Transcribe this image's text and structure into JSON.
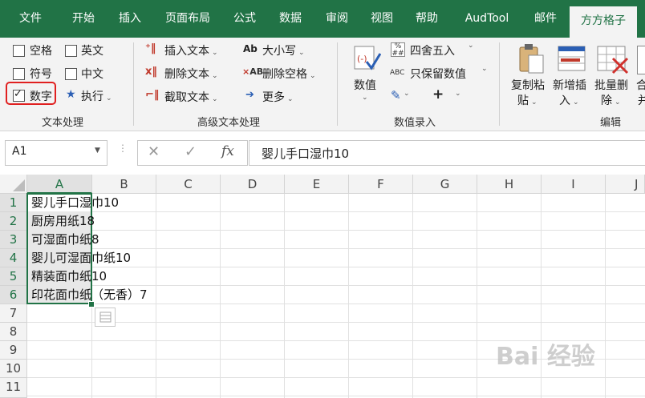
{
  "tabs": [
    "文件",
    "开始",
    "插入",
    "页面布局",
    "公式",
    "数据",
    "审阅",
    "视图",
    "帮助",
    "AudTool",
    "邮件",
    "方方格子"
  ],
  "active_tab": "方方格子",
  "ribbon": {
    "text_processing": {
      "checkboxes": {
        "space": "空格",
        "english": "英文",
        "symbol": "符号",
        "chinese": "中文",
        "digit": "数字"
      },
      "execute_label": "执行",
      "group_label": "文本处理"
    },
    "advanced_text": {
      "insert_text": "插入文本",
      "delete_text": "删除文本",
      "extract_text": "截取文本",
      "case_prefix": "Ab",
      "case_label": "大小写",
      "del_space_prefix": "AB",
      "del_space_label": "删除空格",
      "more_label": "更多",
      "group_label": "高级文本处理"
    },
    "number_entry": {
      "value_label": "数值",
      "round_label": "四舍五入",
      "keep_prefix": "ABC",
      "keep_value_label": "只保留数值",
      "plus_label": "+",
      "group_label": "数值录入"
    },
    "edit": {
      "copy_paste_l1": "复制粘",
      "copy_paste_l2": "贴",
      "new_insert_l1": "新增插",
      "new_insert_l2": "入",
      "batch_delete_l1": "批量删",
      "batch_delete_l2": "除",
      "cut_l1": "合",
      "cut_l2": "并",
      "group_label": "编辑"
    }
  },
  "formula_bar": {
    "name_box": "A1",
    "fx_label": "fx",
    "formula": "婴儿手口湿巾10"
  },
  "columns": [
    "A",
    "B",
    "C",
    "D",
    "E",
    "F",
    "G",
    "H",
    "I",
    "J"
  ],
  "rows": [
    "1",
    "2",
    "3",
    "4",
    "5",
    "6",
    "7",
    "8",
    "9",
    "10",
    "11"
  ],
  "cells": [
    "婴儿手口湿巾10",
    "厨房用纸18",
    "可湿面巾纸8",
    "婴儿可湿面巾纸10",
    "精装面巾纸10",
    "印花面巾纸（无香）7"
  ],
  "watermark": "Bai 经验"
}
